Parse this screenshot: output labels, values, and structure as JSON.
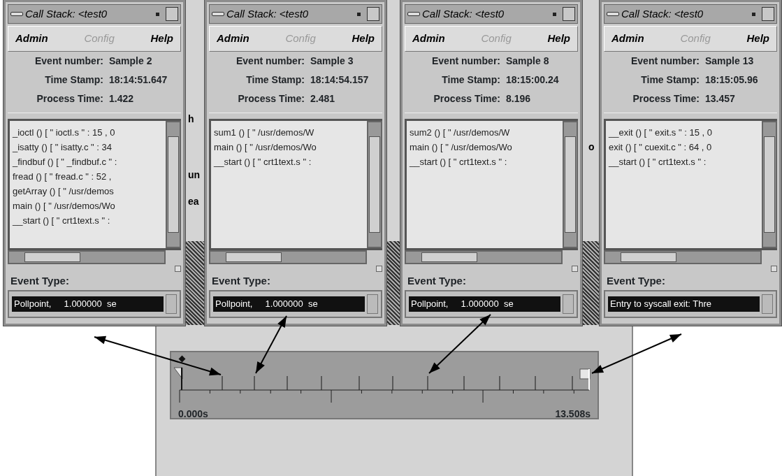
{
  "background_fragments": [
    "h",
    "un",
    "ea",
    "o"
  ],
  "windows": [
    {
      "title": "Call Stack: <test0",
      "menu": [
        {
          "label": "Admin",
          "disabled": false
        },
        {
          "label": "Config",
          "disabled": true
        },
        {
          "label": "Help",
          "disabled": false
        }
      ],
      "fields": [
        {
          "label": "Event number:",
          "value": "Sample 2"
        },
        {
          "label": "Time Stamp:",
          "value": "18:14:51.647"
        },
        {
          "label": "Process Time:",
          "value": "1.422"
        }
      ],
      "stack": [
        "_ioctl () [ \" ioctl.s \" : 15 , 0",
        "_isatty () [ \" isatty.c \" : 34",
        "_findbuf () [ \" _findbuf.c \" :",
        "fread () [ \" fread.c \" : 52 ,",
        "getArray () [ \" /usr/demos",
        "main () [ \" /usr/demos/Wo",
        "__start () [ \" crt1text.s \" :"
      ],
      "event_type_label": "Event Type:",
      "event_type": "Pollpoint,     1.000000  se"
    },
    {
      "title": "Call Stack: <test0",
      "menu": [
        {
          "label": "Admin",
          "disabled": false
        },
        {
          "label": "Config",
          "disabled": true
        },
        {
          "label": "Help",
          "disabled": false
        }
      ],
      "fields": [
        {
          "label": "Event number:",
          "value": "Sample 3"
        },
        {
          "label": "Time Stamp:",
          "value": "18:14:54.157"
        },
        {
          "label": "Process Time:",
          "value": "2.481"
        }
      ],
      "stack": [
        "sum1 () [ \" /usr/demos/W",
        "main () [ \" /usr/demos/Wo",
        "__start () [ \" crt1text.s \" :"
      ],
      "event_type_label": "Event Type:",
      "event_type": "Pollpoint,     1.000000  se"
    },
    {
      "title": "Call Stack: <test0",
      "menu": [
        {
          "label": "Admin",
          "disabled": false
        },
        {
          "label": "Config",
          "disabled": true
        },
        {
          "label": "Help",
          "disabled": false
        }
      ],
      "fields": [
        {
          "label": "Event number:",
          "value": "Sample 8"
        },
        {
          "label": "Time Stamp:",
          "value": "18:15:00.24"
        },
        {
          "label": "Process Time:",
          "value": "8.196"
        }
      ],
      "stack": [
        "sum2 () [ \" /usr/demos/W",
        "main () [ \" /usr/demos/Wo",
        "__start () [ \" crt1text.s \" :"
      ],
      "event_type_label": "Event Type:",
      "event_type": "Pollpoint,     1.000000  se"
    },
    {
      "title": "Call Stack: <test0",
      "menu": [
        {
          "label": "Admin",
          "disabled": false
        },
        {
          "label": "Config",
          "disabled": true
        },
        {
          "label": "Help",
          "disabled": false
        }
      ],
      "fields": [
        {
          "label": "Event number:",
          "value": "Sample 13"
        },
        {
          "label": "Time Stamp:",
          "value": "18:15:05.96"
        },
        {
          "label": "Process Time:",
          "value": "13.457"
        }
      ],
      "stack": [
        "__exit () [ \" exit.s \" : 15 , 0",
        "exit () [ \" cuexit.c \" : 64 , 0",
        "__start () [ \" crt1text.s \" :"
      ],
      "event_type_label": "Event Type:",
      "event_type": "Entry to syscall exit: Thre"
    }
  ],
  "timeline": {
    "start_label": "0.000s",
    "end_label": "13.508s"
  }
}
